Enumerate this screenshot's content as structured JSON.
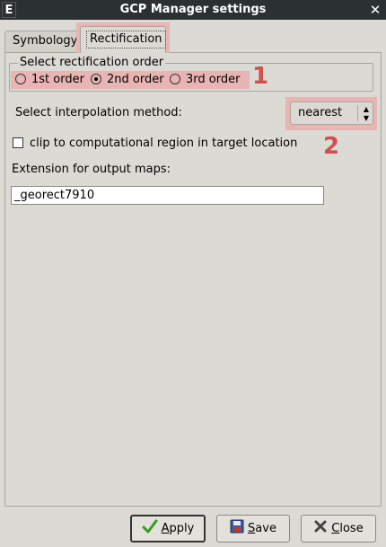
{
  "window": {
    "app_icon_glyph": "E",
    "title": "GCP Manager settings",
    "close_glyph": "✕"
  },
  "tabs": [
    {
      "label": "Symbology"
    },
    {
      "label": "Rectification",
      "selected": true
    }
  ],
  "order": {
    "frame_title": "Select rectification order",
    "options": [
      {
        "label": "1st order",
        "selected": false
      },
      {
        "label": "2nd order",
        "selected": true
      },
      {
        "label": "3rd order",
        "selected": false
      }
    ],
    "annotation": "1"
  },
  "interpolation": {
    "label": "Select interpolation method:",
    "value": "nearest",
    "annotation": "2"
  },
  "clip": {
    "label": "clip to computational region in target location",
    "checked": false
  },
  "extension": {
    "label": "Extension for output maps:",
    "value": "_georect7910"
  },
  "buttons": {
    "apply_label_first": "A",
    "apply_label_rest": "pply",
    "save_label_first": "S",
    "save_label_rest": "ave",
    "close_label_first": "C",
    "close_label_rest": "lose"
  },
  "colors": {
    "highlight": "#e9b4b4",
    "annotation": "#d05050"
  },
  "icons": {
    "apply": "check-icon",
    "save": "floppy-disk-icon",
    "close": "x-close-icon"
  }
}
